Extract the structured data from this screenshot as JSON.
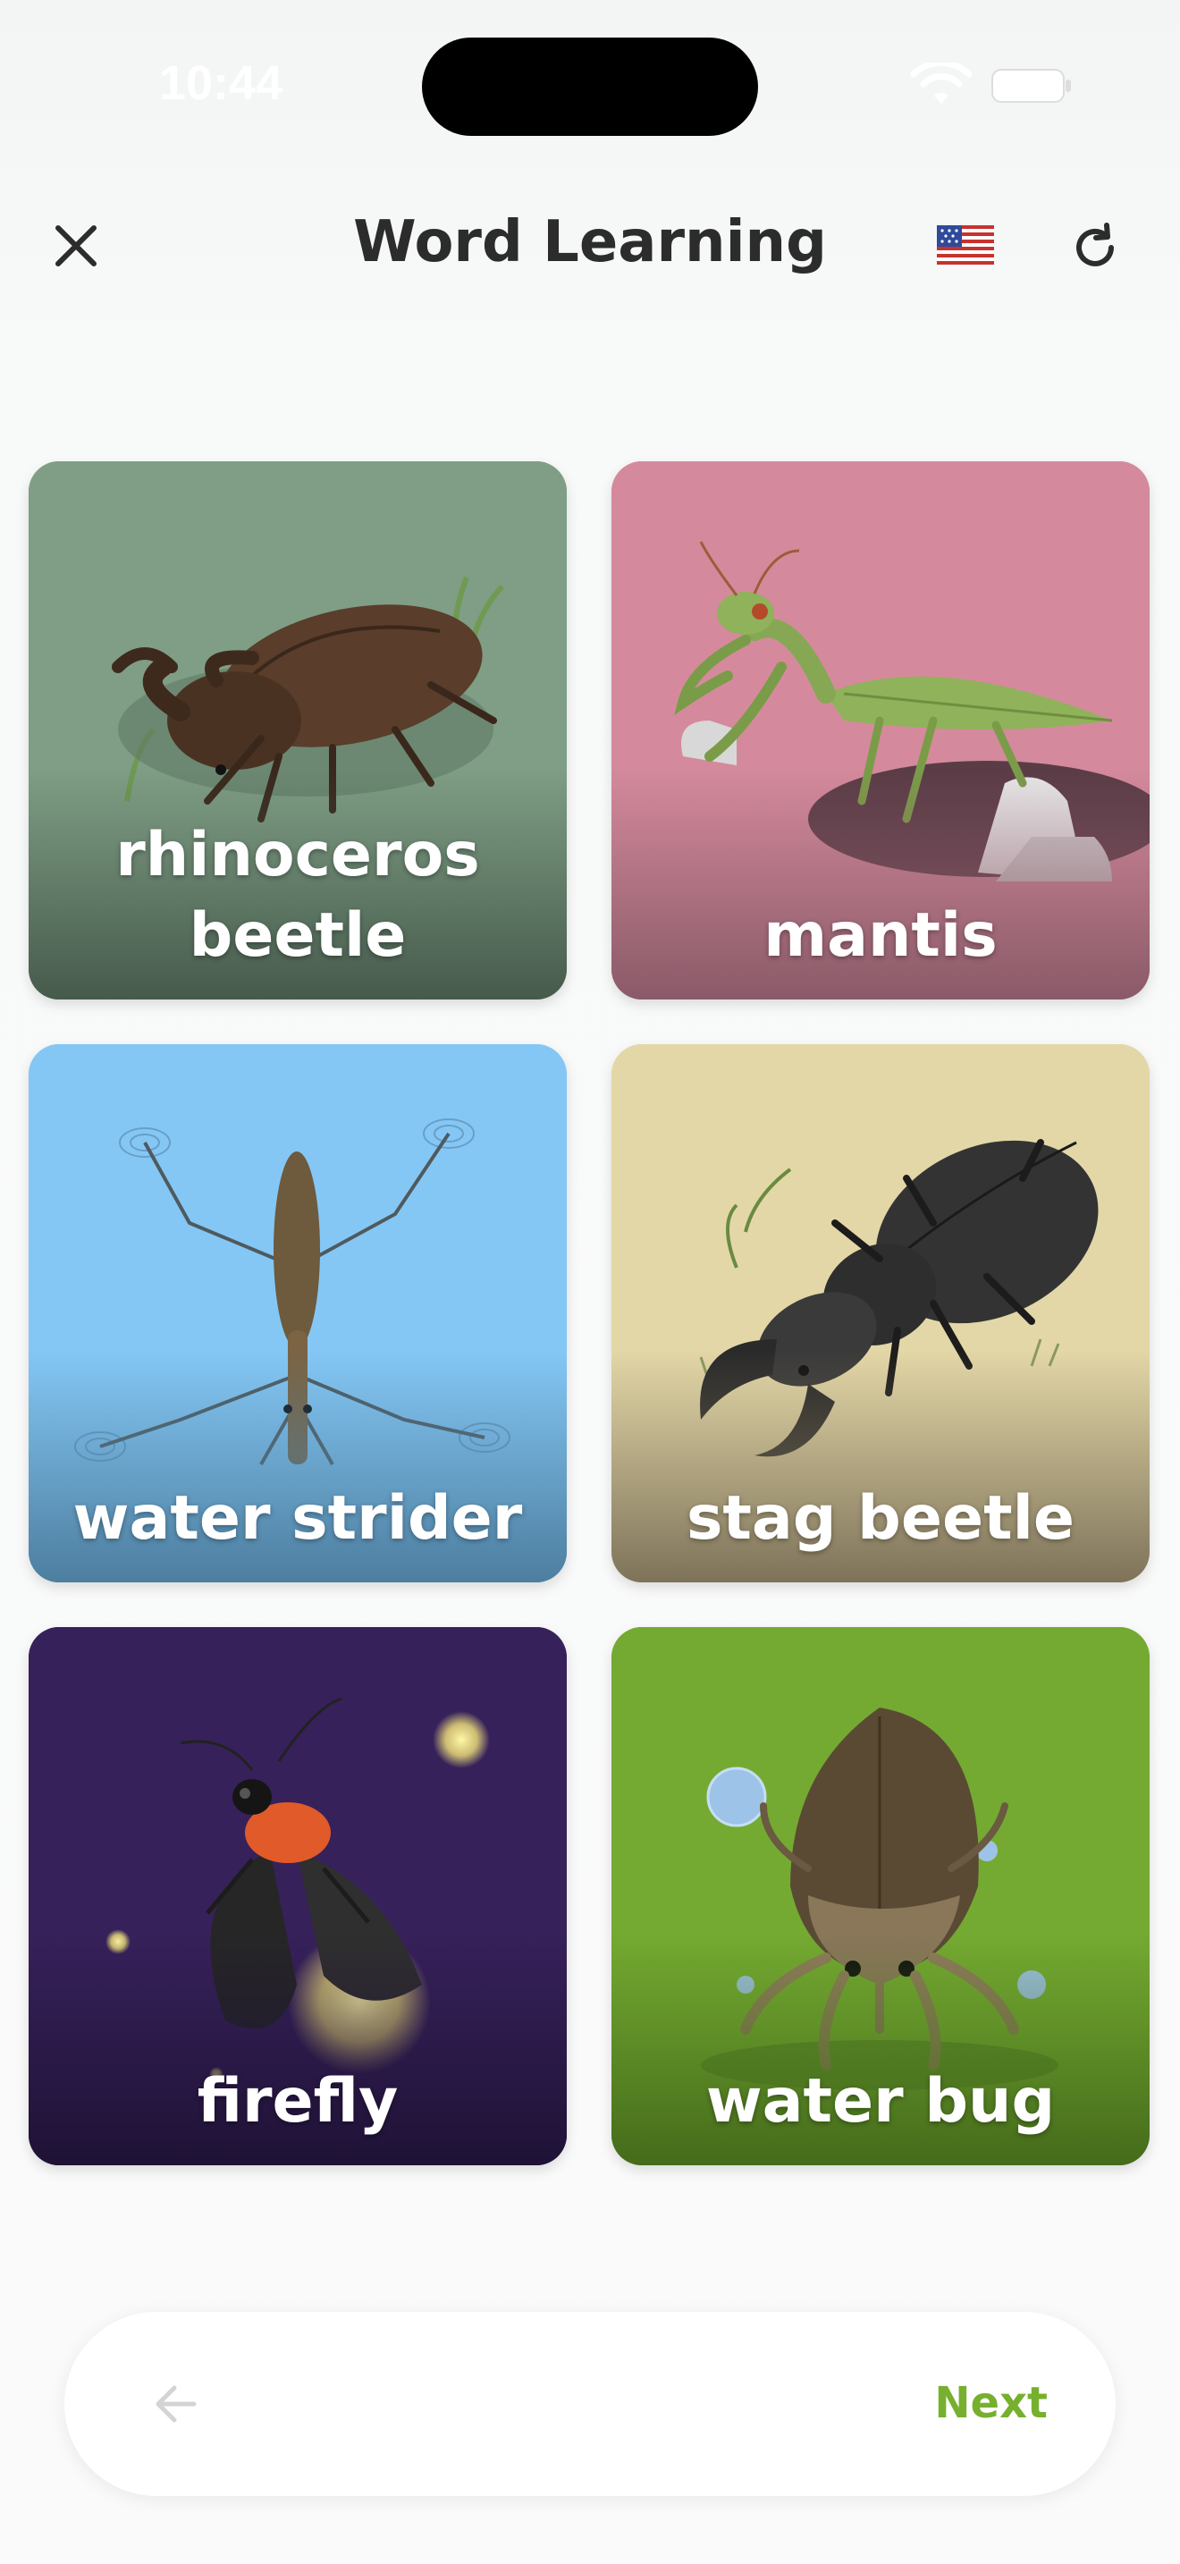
{
  "status_bar": {
    "time": "10:44"
  },
  "header": {
    "title": "Word Learning",
    "close_icon": "close-icon",
    "language_flag": "us-flag-icon",
    "refresh_icon": "refresh-icon"
  },
  "cards": [
    {
      "word": "rhinoceros\nbeetle",
      "background": "#7f9e85",
      "shade": "#465a4c"
    },
    {
      "word": "mantis",
      "background": "#d48a9c",
      "shade": "#8a5a68"
    },
    {
      "word": "water strider",
      "background": "#84c7f5",
      "shade": "#4d7e9f"
    },
    {
      "word": "stag beetle",
      "background": "#e3d7a7",
      "shade": "#7e735a"
    },
    {
      "word": "firefly",
      "background": "#36215a",
      "shade": "#1f1236"
    },
    {
      "word": "water bug",
      "background": "#74aa31",
      "shade": "#456b1b"
    }
  ],
  "nav": {
    "next_label": "Next",
    "back_icon": "arrow-left-icon",
    "accent": "#77b02f"
  }
}
